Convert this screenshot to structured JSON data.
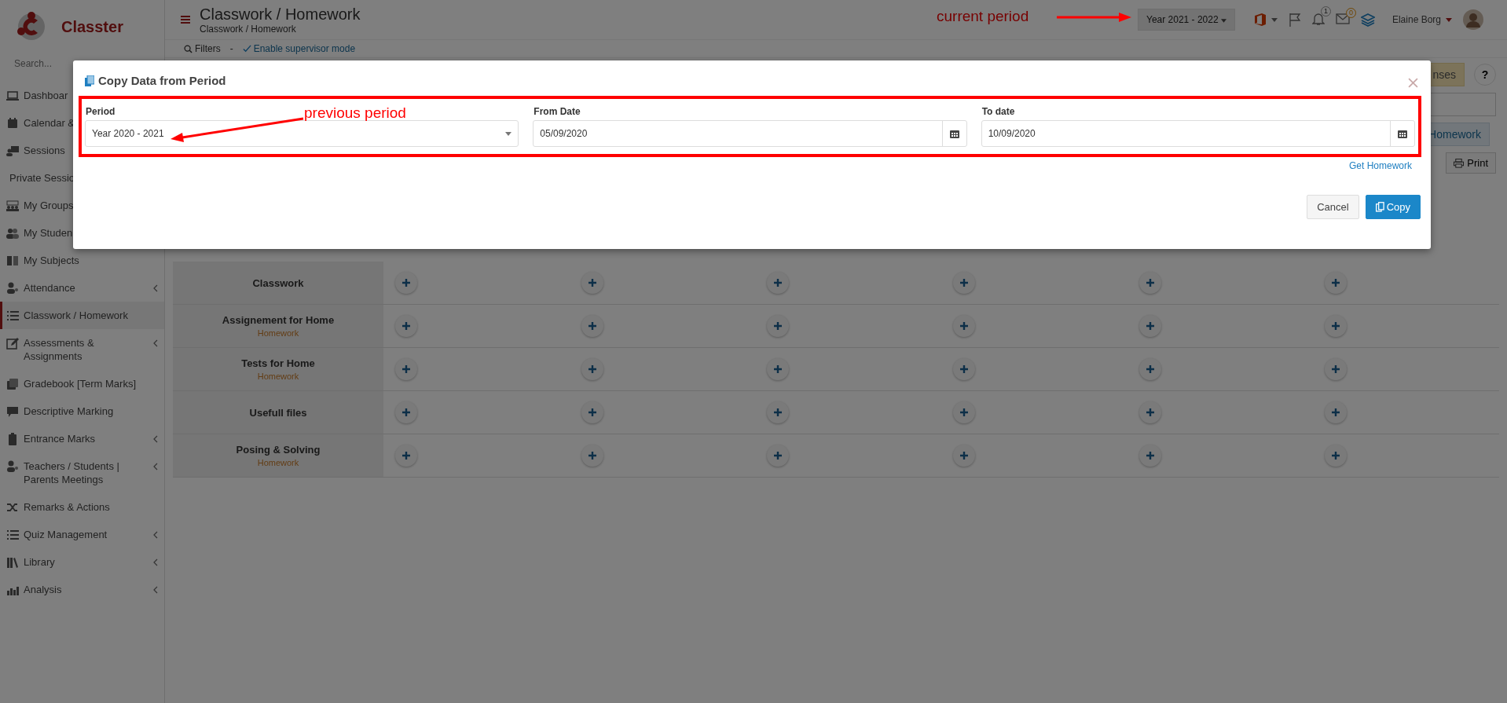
{
  "app": {
    "name": "Classter"
  },
  "sidebar": {
    "search_placeholder": "Search...",
    "items": [
      {
        "label": "Dashboar",
        "selected": false,
        "has_submenu": false
      },
      {
        "label": "Calendar &",
        "selected": false,
        "has_submenu": false
      },
      {
        "label": "Sessions",
        "selected": false,
        "has_submenu": false
      },
      {
        "label": "Private Sessio",
        "selected": false,
        "has_submenu": false
      },
      {
        "label": "My Groups",
        "selected": false,
        "has_submenu": false
      },
      {
        "label": "My Studen",
        "selected": false,
        "has_submenu": false
      },
      {
        "label": "My Subjects",
        "selected": false,
        "has_submenu": false
      },
      {
        "label": "Attendance",
        "selected": false,
        "has_submenu": true
      },
      {
        "label": "Classwork / Homework",
        "selected": true,
        "has_submenu": false
      },
      {
        "label": "Assessments & Assignments",
        "selected": false,
        "has_submenu": true
      },
      {
        "label": "Gradebook [Term Marks]",
        "selected": false,
        "has_submenu": false
      },
      {
        "label": "Descriptive Marking",
        "selected": false,
        "has_submenu": false
      },
      {
        "label": "Entrance Marks",
        "selected": false,
        "has_submenu": true
      },
      {
        "label": "Teachers / Students | Parents Meetings",
        "selected": false,
        "has_submenu": true
      },
      {
        "label": "Remarks & Actions",
        "selected": false,
        "has_submenu": false
      },
      {
        "label": "Quiz Management",
        "selected": false,
        "has_submenu": true
      },
      {
        "label": "Library",
        "selected": false,
        "has_submenu": true
      },
      {
        "label": "Analysis",
        "selected": false,
        "has_submenu": true
      }
    ]
  },
  "header": {
    "title": "Classwork / Homework",
    "breadcrumb": "Classwork / Homework",
    "filters": "Filters",
    "separator": "-",
    "supervisor_link": "Enable supervisor mode",
    "period": "Year 2021 - 2022",
    "notifications_badge": "1",
    "messages_badge": "0",
    "user": "Elaine Borg"
  },
  "toolbar": {
    "responses_button": "nses",
    "help_button": "?",
    "homework_button": "Homework",
    "print_button": "Print"
  },
  "grid": {
    "rows": [
      {
        "label": "Classwork"
      },
      {
        "label": "Assignement for Home",
        "sublabel": "Homework"
      },
      {
        "label": "Tests for Home",
        "sublabel": "Homework"
      },
      {
        "label": "Usefull files"
      },
      {
        "label": "Posing & Solving",
        "sublabel": "Homework"
      }
    ]
  },
  "modal": {
    "title": "Copy Data from Period",
    "fields": [
      {
        "kind": "select",
        "label": "Period",
        "value": "Year 2020 - 2021"
      },
      {
        "kind": "date",
        "label": "From Date",
        "value": "05/09/2020"
      },
      {
        "kind": "date",
        "label": "To date",
        "value": "10/09/2020"
      }
    ],
    "link": "Get Homework",
    "buttons": [
      {
        "kind": "default",
        "label": "Cancel"
      },
      {
        "kind": "primary",
        "label": "Copy"
      }
    ]
  },
  "annotations": [
    {
      "text": "current period"
    },
    {
      "text": "previous period"
    }
  ]
}
